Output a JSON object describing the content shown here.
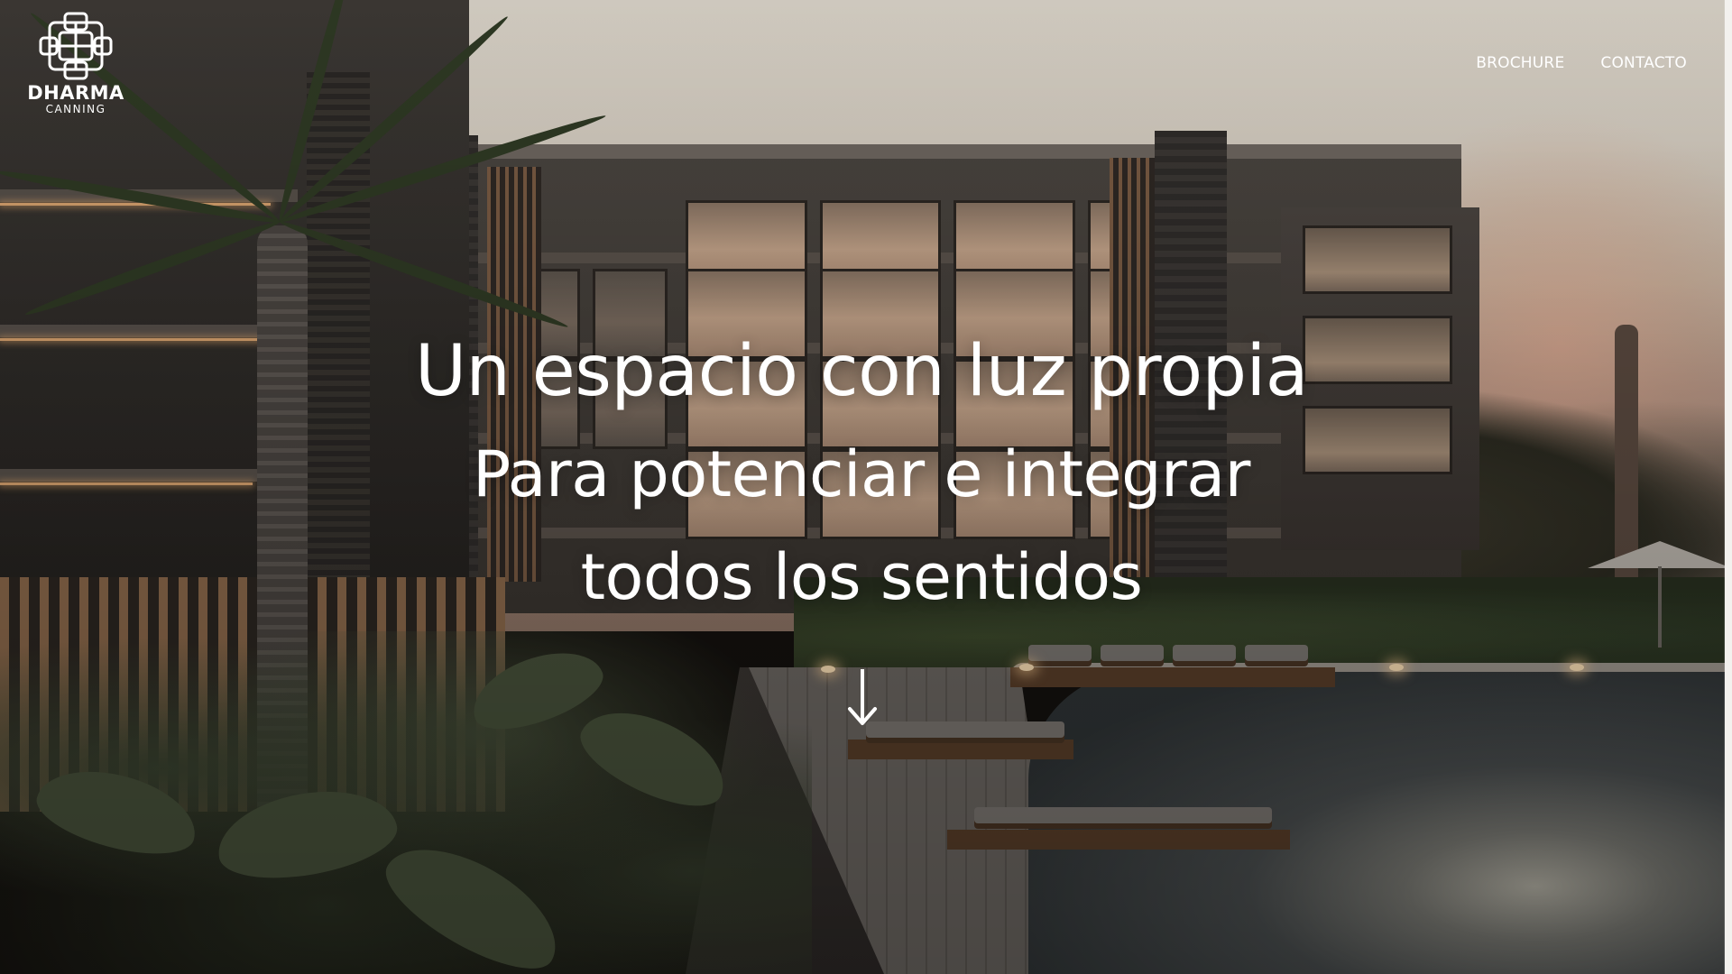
{
  "brand": {
    "name": "DHARMA",
    "subtitle": "CANNING",
    "logo_icon": "dharma-knot-logo"
  },
  "nav": {
    "items": [
      {
        "label": "BROCHURE"
      },
      {
        "label": "CONTACTO"
      }
    ]
  },
  "hero": {
    "line1": "Un espacio con luz propia",
    "line2": "Para potenciar e integrar",
    "line3": "todos los sentidos",
    "scroll_icon": "arrow-down-icon"
  },
  "colors": {
    "text": "#ffffff",
    "accent_light": "#d9a36f"
  }
}
